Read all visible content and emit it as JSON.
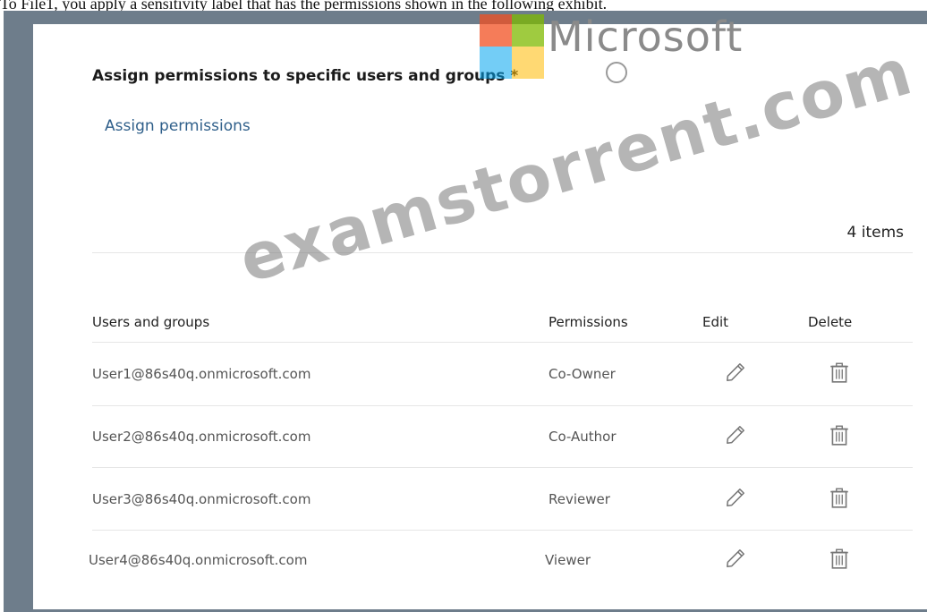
{
  "caption": "To File1, you apply a sensitivity label that has the permissions shown in the following exhibit.",
  "watermark": "examstorrent.com",
  "logo_text": "Microsoft",
  "logo_colors": [
    "#f25022",
    "#7fba00",
    "#00a4ef",
    "#ffb900"
  ],
  "panel": {
    "heading": "Assign permissions to specific users and groups *",
    "assign_link": "Assign permissions",
    "item_count": "4 items"
  },
  "table": {
    "columns": [
      "Users and groups",
      "Permissions",
      "Edit",
      "Delete"
    ],
    "rows": [
      {
        "user": "User1@86s40q.onmicrosoft.com",
        "permission": "Co-Owner"
      },
      {
        "user": "User2@86s40q.onmicrosoft.com",
        "permission": "Co-Author"
      },
      {
        "user": "User3@86s40q.onmicrosoft.com",
        "permission": "Reviewer"
      },
      {
        "user": "User4@86s40q.onmicrosoft.com",
        "permission": "Viewer"
      }
    ],
    "edit_icon": "pencil-icon",
    "delete_icon": "trash-icon"
  },
  "colors": {
    "frame": "#6e7d8b",
    "link": "#2f5f8a"
  }
}
